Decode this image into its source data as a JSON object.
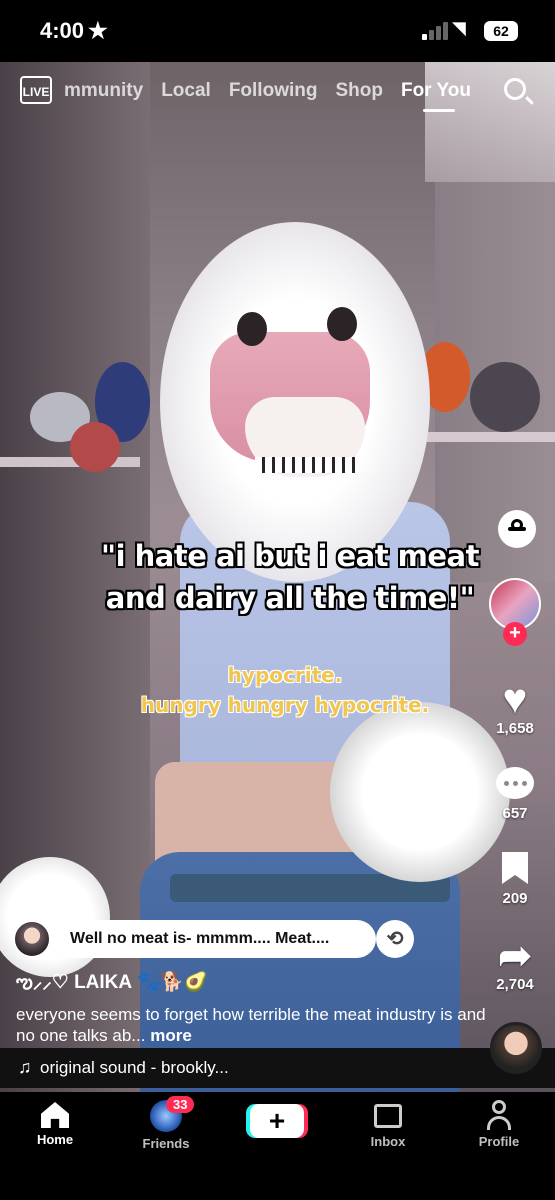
{
  "status_bar": {
    "time": "4:00",
    "battery": "62"
  },
  "top_nav": {
    "live_label": "LIVE",
    "tabs": [
      {
        "label": "mmunity"
      },
      {
        "label": "Local"
      },
      {
        "label": "Following"
      },
      {
        "label": "Shop"
      },
      {
        "label": "For You",
        "active": true
      }
    ]
  },
  "video": {
    "caption_main": "\"i hate ai but i eat meat and dairy all the time!\"",
    "caption_sub_1": "hypocrite.",
    "caption_sub_2": "hungry hungry hypocrite."
  },
  "actions": {
    "likes": "1,658",
    "comments": "657",
    "saves": "209",
    "shares": "2,704"
  },
  "comment_preview": {
    "text": "Well no meat is- mmmm.... Meat...."
  },
  "post": {
    "username": "ఌ︎⸝⸝♡ LAIKA 🐾🐕🥑",
    "description": "everyone seems to forget how terrible the meat industry is and no one talks ab...",
    "more": "more"
  },
  "sound": {
    "label": "original sound - brookly..."
  },
  "bottom_nav": {
    "home": "Home",
    "friends": "Friends",
    "friends_badge": "33",
    "create": "+",
    "inbox": "Inbox",
    "profile": "Profile"
  },
  "colors": {
    "accent_red": "#fe2c55",
    "accent_cyan": "#25f4ee",
    "caption_yellow": "#f0c64e"
  }
}
